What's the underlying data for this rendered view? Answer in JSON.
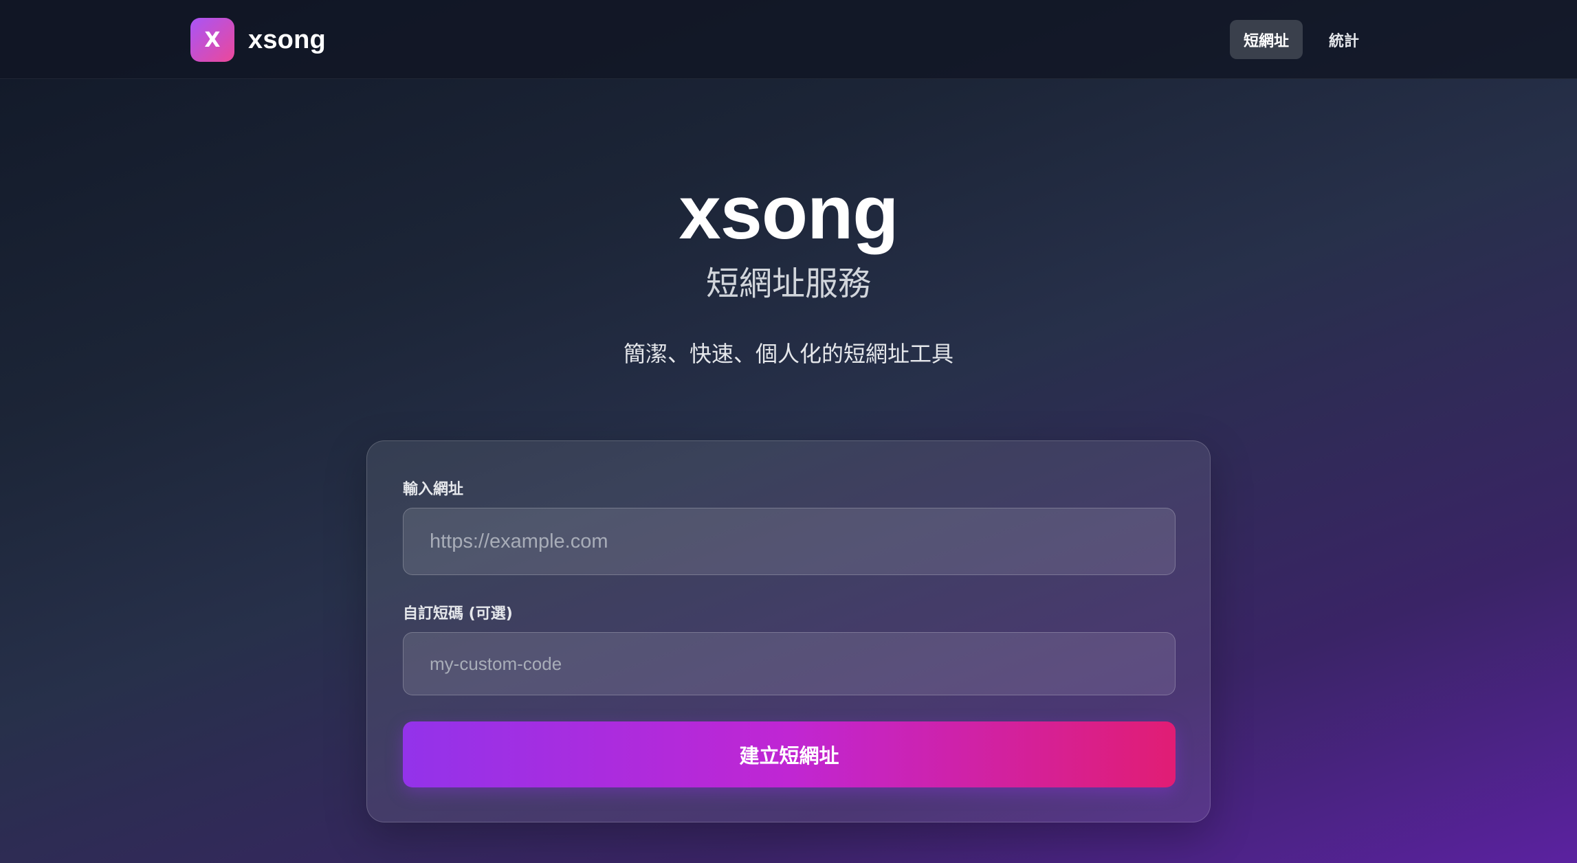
{
  "brand": {
    "logo_letter": "X",
    "name": "xsong"
  },
  "nav": {
    "items": [
      {
        "label": "短網址",
        "active": true
      },
      {
        "label": "統計",
        "active": false
      }
    ]
  },
  "hero": {
    "title": "xsong",
    "subtitle": "短網址服務",
    "tagline": "簡潔、快速、個人化的短網址工具"
  },
  "form": {
    "url_label": "輸入網址",
    "url_placeholder": "https://example.com",
    "url_value": "",
    "code_label": "自訂短碼 (可選)",
    "code_placeholder": "my-custom-code",
    "code_value": "",
    "submit_label": "建立短網址"
  },
  "colors": {
    "accent_start": "#9333ea",
    "accent_end": "#e11d74",
    "logo_gradient_start": "#a855f7",
    "logo_gradient_end": "#ec4899"
  }
}
